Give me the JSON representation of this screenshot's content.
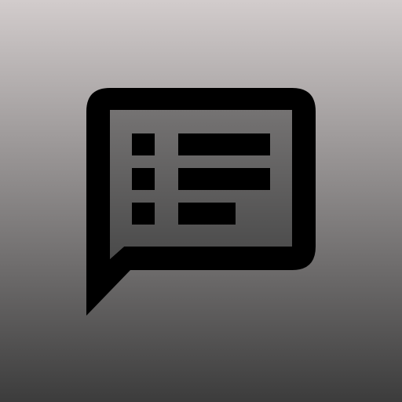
{
  "icon": {
    "name": "chat-list-icon"
  },
  "colors": {
    "background_top": "#d2cccc",
    "background_bottom": "#3c3c3c",
    "outline": "#000000",
    "bubble_fill_top": "#757373",
    "bubble_fill_bottom": "#4a4a4a"
  }
}
